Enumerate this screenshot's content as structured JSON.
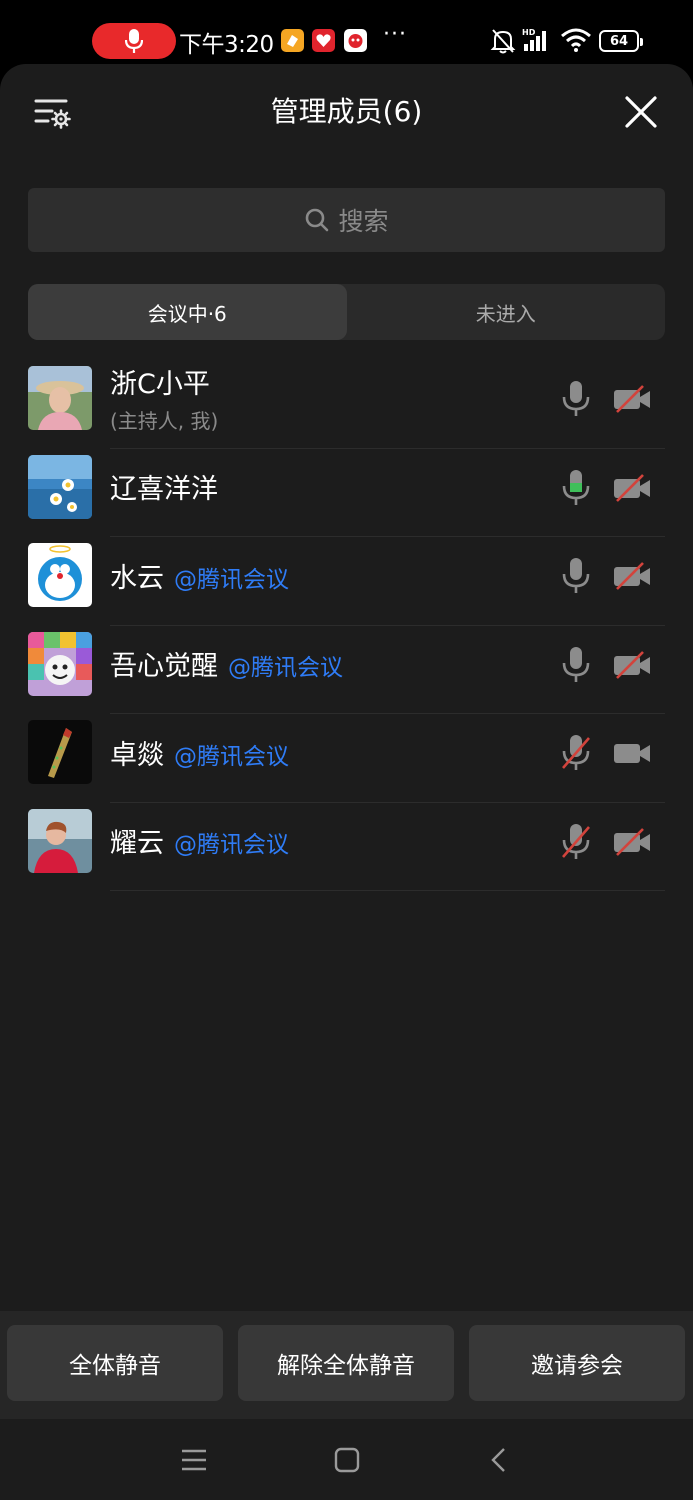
{
  "status_bar": {
    "time": "下午3:20",
    "battery": "64",
    "more_indicator": "···",
    "icons": [
      "mic-icon",
      "app-badge-icon",
      "app-heart-icon",
      "app-mascot-icon",
      "bell-muted-icon",
      "signal-icon",
      "wifi-icon",
      "battery-icon"
    ]
  },
  "header": {
    "title": "管理成员(6)"
  },
  "search": {
    "placeholder": "搜索"
  },
  "tabs": [
    {
      "label": "会议中·6",
      "active": true
    },
    {
      "label": "未进入",
      "active": false
    }
  ],
  "members": [
    {
      "name": "浙C小平",
      "tag": "",
      "role": "(主持人, 我)",
      "mic": "on",
      "camera": "off"
    },
    {
      "name": "辽喜洋洋",
      "tag": "",
      "role": "",
      "mic": "on",
      "camera": "off"
    },
    {
      "name": "水云",
      "tag": "@腾讯会议",
      "role": "",
      "mic": "on",
      "camera": "off"
    },
    {
      "name": "吾心觉醒",
      "tag": "@腾讯会议",
      "role": "",
      "mic": "on",
      "camera": "off"
    },
    {
      "name": "卓燚",
      "tag": "@腾讯会议",
      "role": "",
      "mic": "off",
      "camera": "on"
    },
    {
      "name": "耀云",
      "tag": "@腾讯会议",
      "role": "",
      "mic": "off",
      "camera": "off"
    }
  ],
  "actions": {
    "mute_all": "全体静音",
    "unmute_all": "解除全体静音",
    "invite": "邀请参会"
  },
  "colors": {
    "accent_blue": "#2f7cf6",
    "muted_red": "#d2433c",
    "mic_on_green": "#3fbf5a",
    "record_red": "#e8292b"
  }
}
